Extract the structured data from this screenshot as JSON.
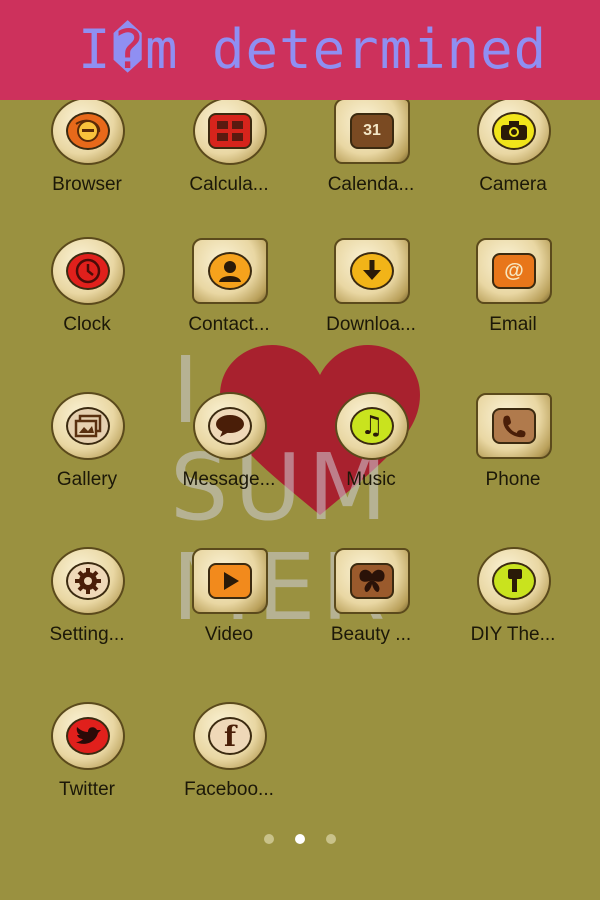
{
  "header": {
    "title": "I�m determined"
  },
  "wallpaper": {
    "line1": "I",
    "line2": "SUM",
    "line3": "MER",
    "heart_color": "#a8212e"
  },
  "apps": [
    {
      "label": "Browser",
      "icon": "browser-icon"
    },
    {
      "label": "Calcula...",
      "icon": "calculator-icon"
    },
    {
      "label": "Calenda...",
      "icon": "calendar-icon",
      "glyph": "31"
    },
    {
      "label": "Camera",
      "icon": "camera-icon"
    },
    {
      "label": "Clock",
      "icon": "clock-icon"
    },
    {
      "label": "Contact...",
      "icon": "contacts-icon"
    },
    {
      "label": "Downloa...",
      "icon": "download-icon"
    },
    {
      "label": "Email",
      "icon": "email-icon",
      "glyph": "@"
    },
    {
      "label": "Gallery",
      "icon": "gallery-icon"
    },
    {
      "label": "Message...",
      "icon": "message-icon"
    },
    {
      "label": "Music",
      "icon": "music-icon",
      "glyph": "♫"
    },
    {
      "label": "Phone",
      "icon": "phone-icon"
    },
    {
      "label": "Setting...",
      "icon": "settings-icon"
    },
    {
      "label": "Video",
      "icon": "video-icon"
    },
    {
      "label": "Beauty ...",
      "icon": "butterfly-icon"
    },
    {
      "label": "DIY The...",
      "icon": "diy-theme-icon"
    },
    {
      "label": "Twitter",
      "icon": "twitter-icon"
    },
    {
      "label": "Faceboo...",
      "icon": "facebook-icon",
      "glyph": "f"
    }
  ],
  "pager": {
    "pages": 3,
    "current": 2
  }
}
